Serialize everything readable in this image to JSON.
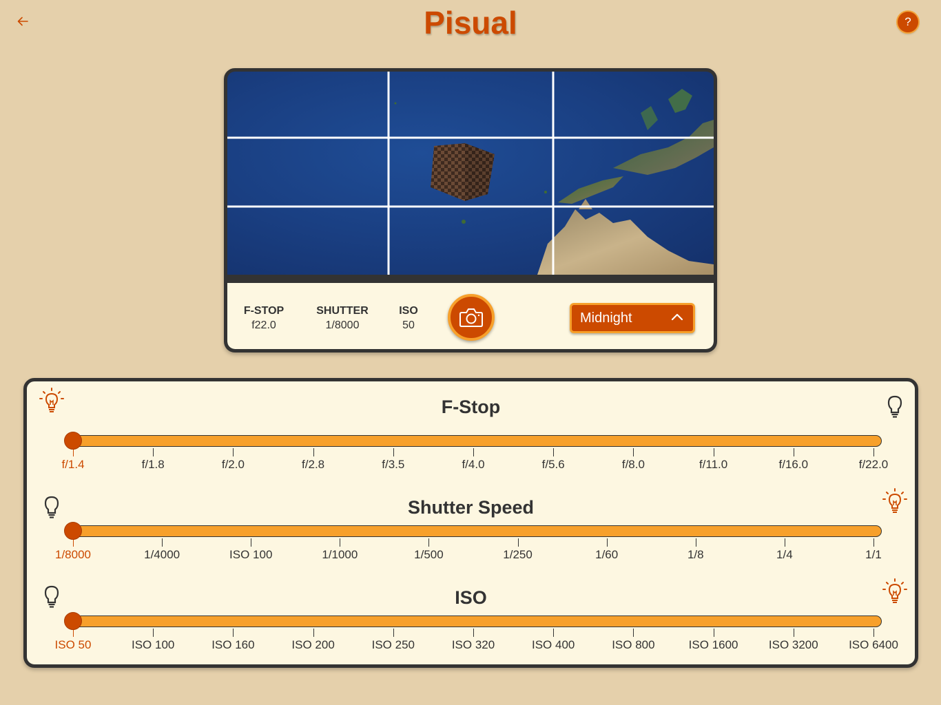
{
  "app": {
    "title": "Pisual",
    "back_icon": "arrow-left-icon",
    "help_label": "?",
    "accent": "#cc4a00",
    "accent_light": "#f7a02b",
    "background": "#e5d0ab",
    "panel": "#fdf7e1"
  },
  "camera": {
    "fstop_label": "F-STOP",
    "fstop_value": "f22.0",
    "shutter_label": "SHUTTER",
    "shutter_value": "1/8000",
    "iso_label": "ISO",
    "iso_value": "50",
    "capture_icon": "camera-icon",
    "preset": "Midnight",
    "preset_icon": "chevron-up-icon"
  },
  "sliders": {
    "fstop": {
      "title": "F-Stop",
      "left_icon": "lightbulb-on-icon",
      "right_icon": "lightbulb-off-icon",
      "ticks": [
        "f/1.4",
        "f/1.8",
        "f/2.0",
        "f/2.8",
        "f/3.5",
        "f/4.0",
        "f/5.6",
        "f/8.0",
        "f/11.0",
        "f/16.0",
        "f/22.0"
      ],
      "selected_index": 0
    },
    "shutter": {
      "title": "Shutter Speed",
      "left_icon": "lightbulb-off-icon",
      "right_icon": "lightbulb-on-icon",
      "ticks": [
        "1/8000",
        "1/4000",
        "ISO 100",
        "1/1000",
        "1/500",
        "1/250",
        "1/60",
        "1/8",
        "1/4",
        "1/1"
      ],
      "selected_index": 0
    },
    "iso": {
      "title": "ISO",
      "left_icon": "lightbulb-off-icon",
      "right_icon": "lightbulb-on-icon",
      "ticks": [
        "ISO 50",
        "ISO 100",
        "ISO 160",
        "ISO 200",
        "ISO 250",
        "ISO 320",
        "ISO 400",
        "ISO 800",
        "ISO 1600",
        "ISO 3200",
        "ISO 6400"
      ],
      "selected_index": 0
    }
  }
}
